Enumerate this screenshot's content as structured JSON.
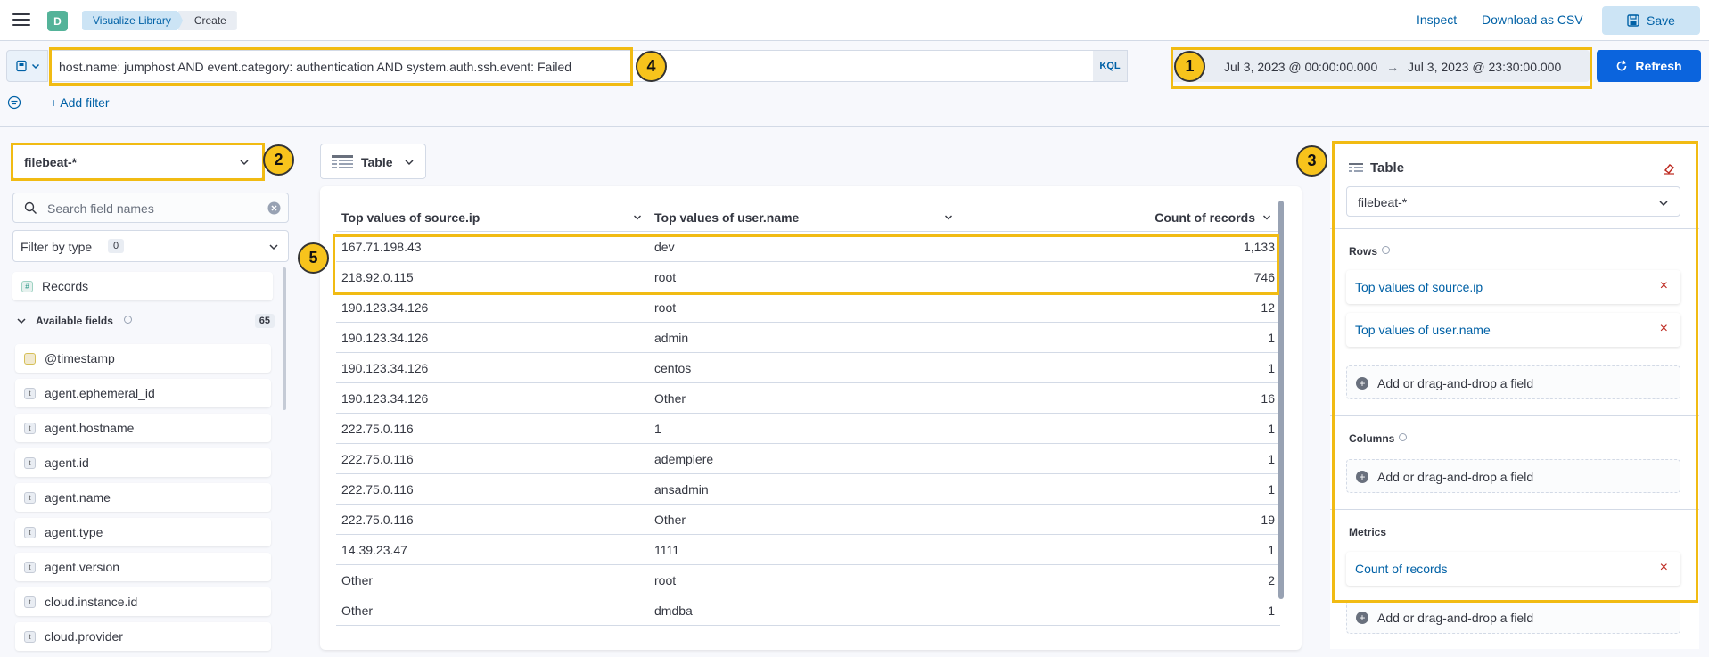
{
  "header": {
    "space_initial": "D",
    "breadcrumbs": [
      "Visualize Library",
      "Create"
    ],
    "inspect": "Inspect",
    "download": "Download as CSV",
    "save": "Save"
  },
  "query": {
    "text": "host.name: jumphost AND event.category: authentication AND system.auth.ssh.event: Failed",
    "language": "KQL",
    "date_start": "Jul 3, 2023 @ 00:00:00.000",
    "date_arrow": "→",
    "date_end": "Jul 3, 2023 @ 23:30:00.000",
    "refresh": "Refresh",
    "add_filter": "+ Add filter"
  },
  "callouts": [
    "1",
    "2",
    "3",
    "4",
    "5"
  ],
  "left": {
    "data_view": "filebeat-*",
    "search_placeholder": "Search field names",
    "filter_by_type": "Filter by type",
    "filter_count": "0",
    "records": "Records",
    "available_fields": "Available fields",
    "available_count": "65",
    "fields": [
      "@timestamp",
      "agent.ephemeral_id",
      "agent.hostname",
      "agent.id",
      "agent.name",
      "agent.type",
      "agent.version",
      "cloud.instance.id",
      "cloud.provider"
    ]
  },
  "center": {
    "chart_type": "Table",
    "columns": [
      "Top values of source.ip",
      "Top values of user.name",
      "Count of records"
    ],
    "rows": [
      [
        "167.71.198.43",
        "dev",
        "1,133"
      ],
      [
        "218.92.0.115",
        "root",
        "746"
      ],
      [
        "190.123.34.126",
        "root",
        "12"
      ],
      [
        "190.123.34.126",
        "admin",
        "1"
      ],
      [
        "190.123.34.126",
        "centos",
        "1"
      ],
      [
        "190.123.34.126",
        "Other",
        "16"
      ],
      [
        "222.75.0.116",
        "1",
        "1"
      ],
      [
        "222.75.0.116",
        "adempiere",
        "1"
      ],
      [
        "222.75.0.116",
        "ansadmin",
        "1"
      ],
      [
        "222.75.0.116",
        "Other",
        "19"
      ],
      [
        "14.39.23.47",
        "1111",
        "1"
      ],
      [
        "Other",
        "root",
        "2"
      ],
      [
        "Other",
        "dmdba",
        "1"
      ]
    ]
  },
  "right": {
    "title": "Table",
    "data_view": "filebeat-*",
    "rows_label": "Rows",
    "columns_label": "Columns",
    "metrics_label": "Metrics",
    "row_dims": [
      "Top values of source.ip",
      "Top values of user.name"
    ],
    "metric_dims": [
      "Count of records"
    ],
    "add_field": "Add or drag-and-drop a field"
  }
}
